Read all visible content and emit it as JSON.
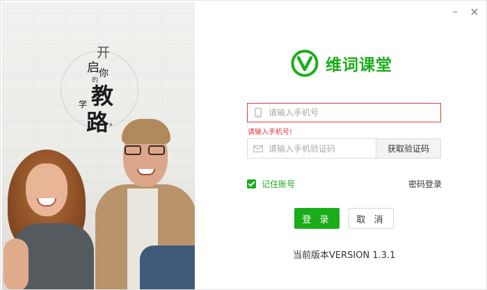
{
  "window": {
    "minimize_label": "–",
    "close_label": "×"
  },
  "slogan": {
    "kai": "开",
    "qi": "启",
    "ni": "你",
    "de": "的",
    "jiao": "教",
    "xue": "学",
    "lu": "路",
    "dot": "。"
  },
  "logo": {
    "text": "维词课堂",
    "icon": "v-logo-icon",
    "color": "#1aad19"
  },
  "form": {
    "phone_placeholder": "请输入手机号",
    "phone_value": "",
    "phone_error": "请输入手机号!",
    "code_placeholder": "请输入手机验证码",
    "code_value": "",
    "get_code_label": "获取验证码",
    "remember_label": "记住账号",
    "remember_checked": true,
    "password_login_label": "密码登录",
    "login_label": "登 录",
    "cancel_label": "取 消"
  },
  "footer": {
    "version": "当前版本VERSION 1.3.1"
  },
  "colors": {
    "accent": "#1aad19",
    "error": "#e4393c"
  }
}
